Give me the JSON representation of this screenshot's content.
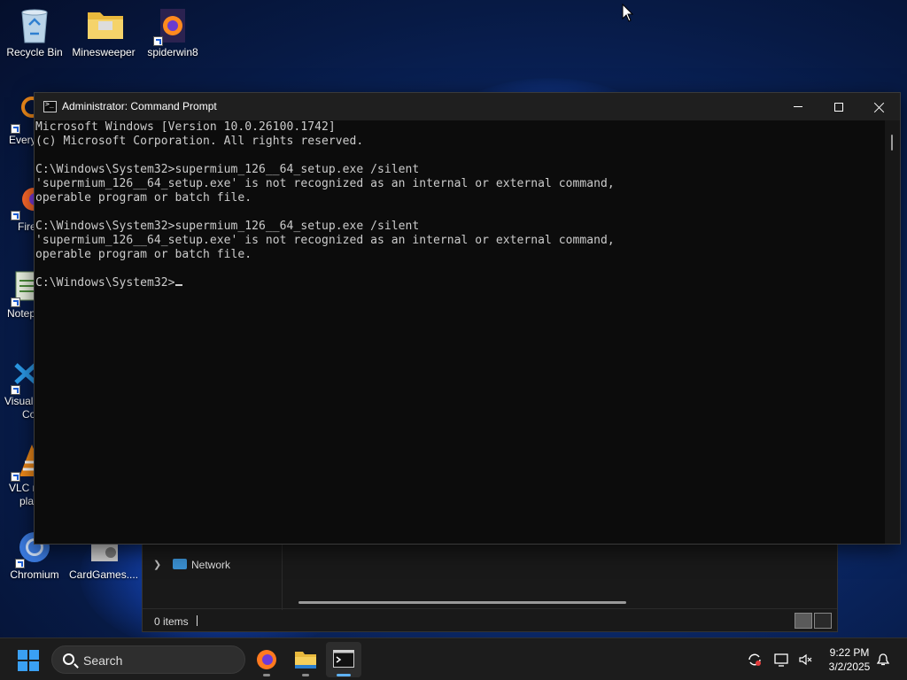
{
  "desktop": {
    "icons": [
      {
        "label": "Recycle Bin"
      },
      {
        "label": "Minesweeper"
      },
      {
        "label": "spiderwin8"
      },
      {
        "label": "Every"
      },
      {
        "label": "Fire"
      },
      {
        "label": "Notep"
      },
      {
        "label": "Visual"
      },
      {
        "label": "Co"
      },
      {
        "label": "VLC m"
      },
      {
        "label": "pla"
      },
      {
        "label": "Chromium"
      },
      {
        "label": "CardGames...."
      }
    ]
  },
  "explorer": {
    "nav_item": "Network",
    "status_items": "0 items"
  },
  "cmd": {
    "title": "Administrator: Command Prompt",
    "lines": [
      "Microsoft Windows [Version 10.0.26100.1742]",
      "(c) Microsoft Corporation. All rights reserved.",
      "",
      "C:\\Windows\\System32>supermium_126__64_setup.exe /silent",
      "'supermium_126__64_setup.exe' is not recognized as an internal or external command,",
      "operable program or batch file.",
      "",
      "C:\\Windows\\System32>supermium_126__64_setup.exe /silent",
      "'supermium_126__64_setup.exe' is not recognized as an internal or external command,",
      "operable program or batch file.",
      ""
    ],
    "prompt": "C:\\Windows\\System32>"
  },
  "taskbar": {
    "search_placeholder": "Search",
    "time": "9:22 PM",
    "date": "3/2/2025"
  },
  "icons": [
    "recycle-bin-icon",
    "folder-icon",
    "firefox-icon",
    "chromium-icon",
    "terminal-icon",
    "search-icon",
    "windows-start-icon",
    "network-icon",
    "notification-bell-icon",
    "sync-icon",
    "volume-muted-icon",
    "display-icon"
  ]
}
